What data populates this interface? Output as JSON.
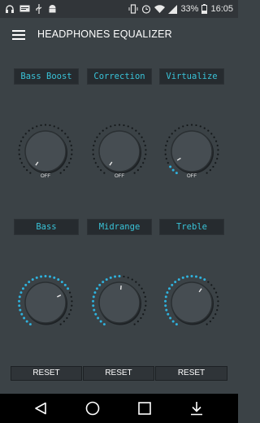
{
  "status_bar": {
    "battery_percent": "33%",
    "time": "16:05"
  },
  "app_bar": {
    "title": "HEADPHONES EQUALIZER"
  },
  "effects": [
    {
      "label": "Bass Boost",
      "state": "OFF",
      "level": 0
    },
    {
      "label": "Correction",
      "state": "OFF",
      "level": 0
    },
    {
      "label": "Virtualize",
      "state": "OFF",
      "level": 0.08
    }
  ],
  "bands": [
    {
      "label": "Bass",
      "level": 0.72
    },
    {
      "label": "Midrange",
      "level": 0.52
    },
    {
      "label": "Treble",
      "level": 0.62
    }
  ],
  "reset_buttons": [
    "RESET",
    "RESET",
    "RESET"
  ],
  "colors": {
    "accent": "#2fb2dd",
    "label_text": "#39c3d8",
    "background": "#3b4246"
  }
}
